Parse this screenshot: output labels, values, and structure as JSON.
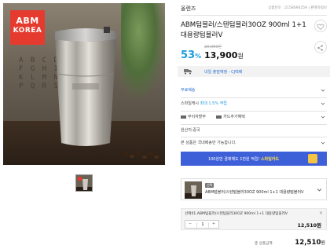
{
  "brand": {
    "line1": "ABM",
    "line2": "KOREA",
    "color": "#e53b2f"
  },
  "photo": {
    "alphabet_deco": "A B C D E\nF G H I J\nK L M N O\nP Q R S T"
  },
  "shop": {
    "name": "올렌즈",
    "meta": "상품번호 : 2158694259  |  판매자정보"
  },
  "product": {
    "title": "ABM텀블러/스텐텀블러30OZ 900ml 1+1 대용량텀블러V",
    "original_price": "29,000원",
    "discount_value": "53",
    "discount_unit": "%",
    "sale_price": "13,900",
    "sale_unit": "원"
  },
  "delivery": {
    "text": "내일 출발예정 - CJ택배",
    "text_color": "#2a6fd1"
  },
  "rows": {
    "shipping": "무료배송",
    "points_prefix": "스마일캐시 ",
    "points_highlight": "최대 1.5% 적립",
    "payments_a": "무이자할부",
    "payments_b": "카드추가혜택",
    "origin": "원산지:중국",
    "notice": "본 상품은 국내배송만 가능합니다."
  },
  "promo": {
    "text": "100원만 결제해도 1만원 적립! ",
    "highlight": "스마일카드",
    "bg_color": "#3d5fd8"
  },
  "option": {
    "tag": "선택",
    "name": "ABM텀블러/스텐텀블러30OZ 900ml 1+1 대용량텀블러V"
  },
  "selected": {
    "name": "선택01.ABM텀블러/스텐텀블러30OZ 900ml 1+1 대용량텀블러V",
    "close": "✕",
    "qty_minus": "−",
    "qty_value": "1",
    "qty_plus": "+",
    "line_price": "12,510원"
  },
  "total": {
    "label": "총 상품금액",
    "value": "12,510",
    "unit": "원"
  }
}
